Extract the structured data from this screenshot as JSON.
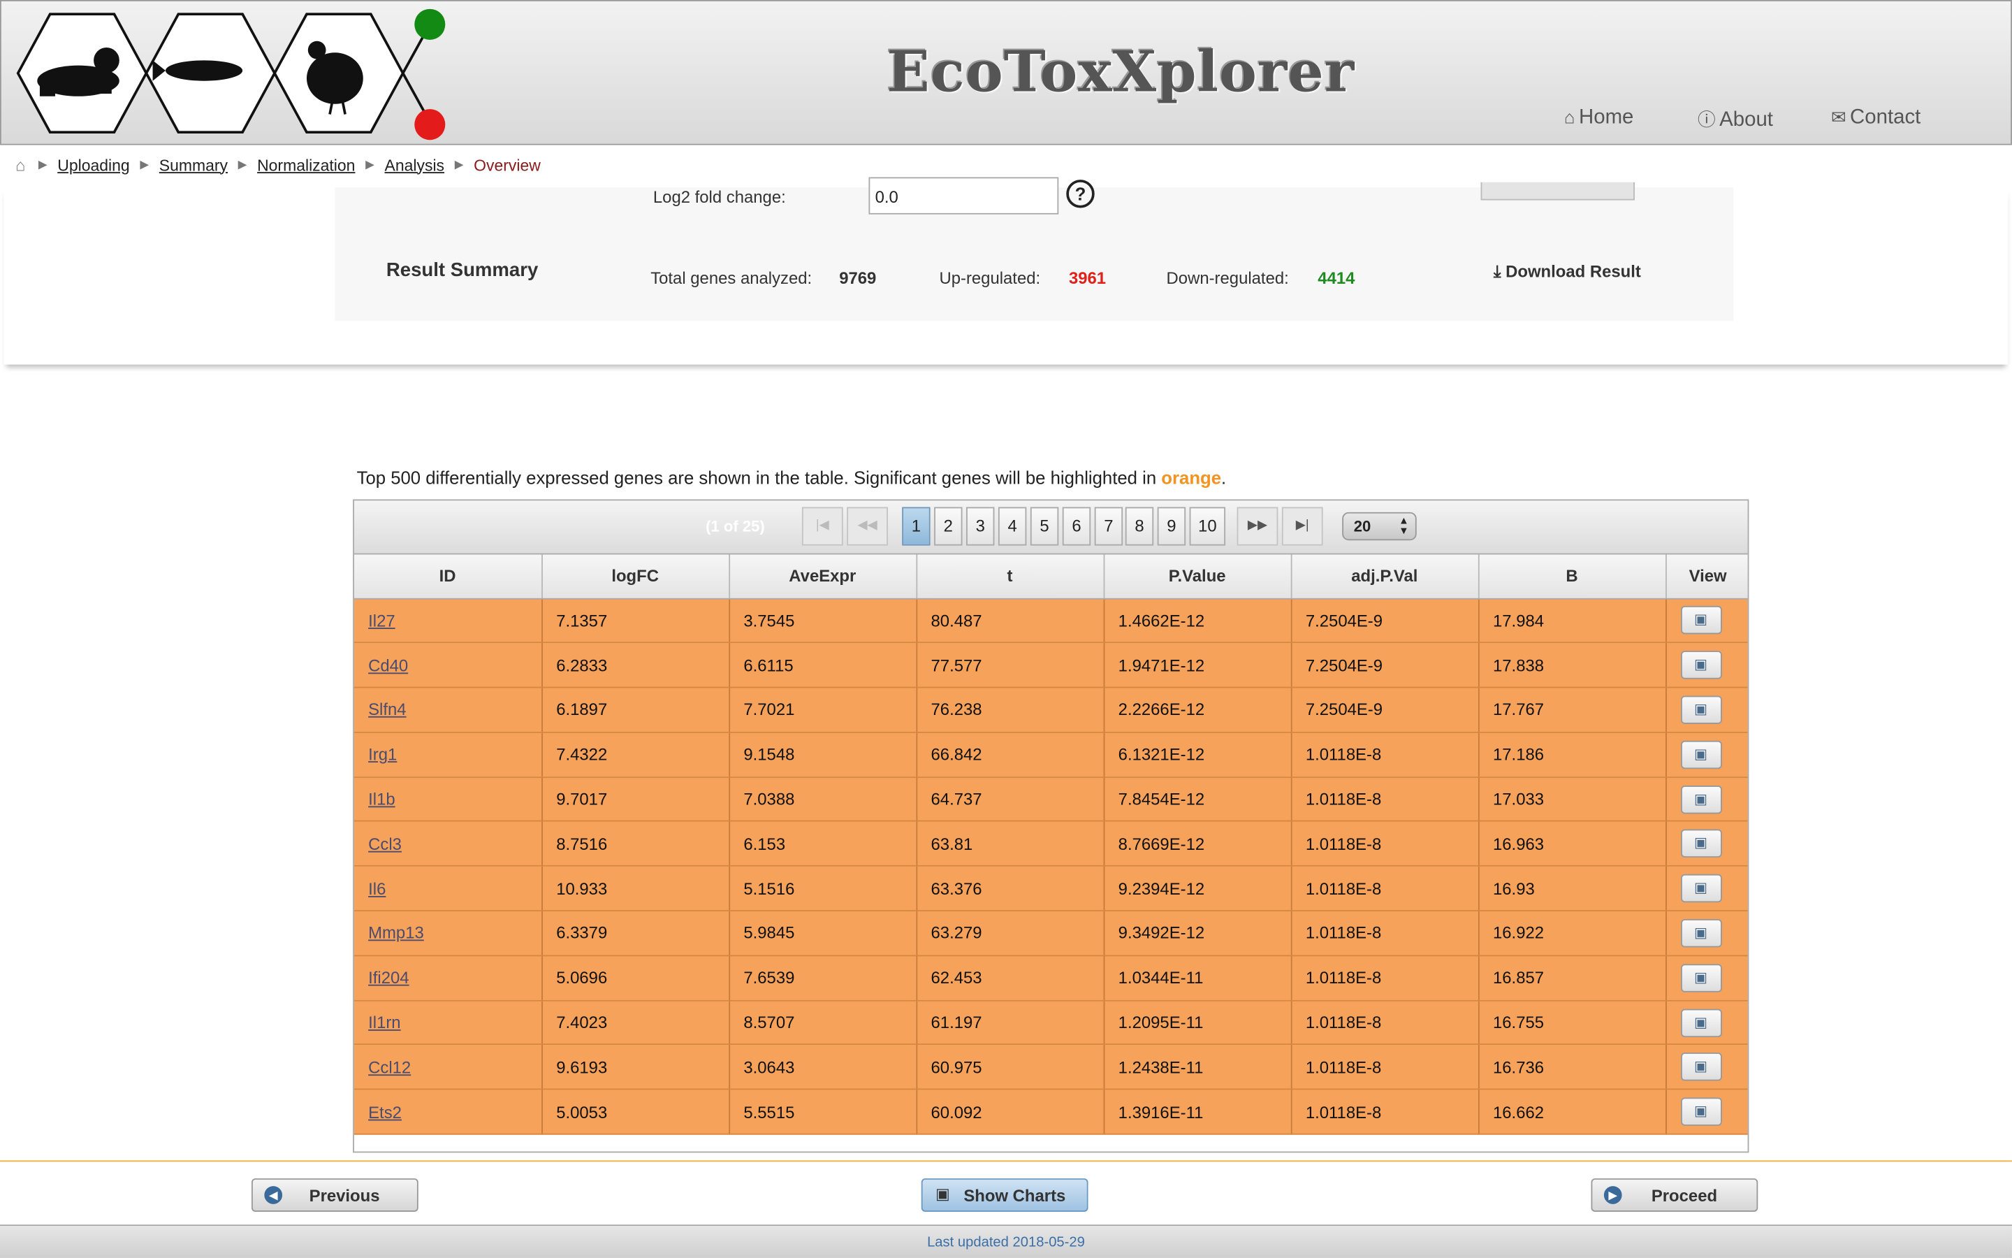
{
  "app": {
    "title": "EcoToxXplorer",
    "nav": {
      "home": "Home",
      "about": "About",
      "contact": "Contact"
    },
    "icons": {
      "home": "home-icon",
      "about": "info-icon",
      "contact": "envelope-icon"
    }
  },
  "breadcrumb": {
    "items": [
      "Uploading",
      "Summary",
      "Normalization",
      "Analysis"
    ],
    "current": "Overview"
  },
  "filter": {
    "fold_change_label": "Log2 fold change:",
    "fold_change_value": "0.0"
  },
  "summary": {
    "title": "Result Summary",
    "total_label": "Total genes analyzed:",
    "total_value": "9769",
    "up_label": "Up-regulated:",
    "up_value": "3961",
    "down_label": "Down-regulated:",
    "down_value": "4414",
    "download_label": "Download Result",
    "colors": {
      "up": "#e0201a",
      "down": "#1f8a1f"
    }
  },
  "intro": {
    "text": "Top 500 differentially expressed genes are shown in the table. Significant genes will be highlighted in ",
    "highlight": "orange",
    "end": "."
  },
  "paginator": {
    "info": "(1 of 25)",
    "pages": [
      "1",
      "2",
      "3",
      "4",
      "5",
      "6",
      "7",
      "8",
      "9",
      "10"
    ],
    "active_page": "1",
    "rows_per_page": "20"
  },
  "table": {
    "columns": [
      "ID",
      "logFC",
      "AveExpr",
      "t",
      "P.Value",
      "adj.P.Val",
      "B",
      "View"
    ],
    "rows": [
      [
        "Il27",
        "7.1357",
        "3.7545",
        "80.487",
        "1.4662E-12",
        "7.2504E-9",
        "17.984"
      ],
      [
        "Cd40",
        "6.2833",
        "6.6115",
        "77.577",
        "1.9471E-12",
        "7.2504E-9",
        "17.838"
      ],
      [
        "Slfn4",
        "6.1897",
        "7.7021",
        "76.238",
        "2.2266E-12",
        "7.2504E-9",
        "17.767"
      ],
      [
        "Irg1",
        "7.4322",
        "9.1548",
        "66.842",
        "6.1321E-12",
        "1.0118E-8",
        "17.186"
      ],
      [
        "Il1b",
        "9.7017",
        "7.0388",
        "64.737",
        "7.8454E-12",
        "1.0118E-8",
        "17.033"
      ],
      [
        "Ccl3",
        "8.7516",
        "6.153",
        "63.81",
        "8.7669E-12",
        "1.0118E-8",
        "16.963"
      ],
      [
        "Il6",
        "10.933",
        "5.1516",
        "63.376",
        "9.2394E-12",
        "1.0118E-8",
        "16.93"
      ],
      [
        "Mmp13",
        "6.3379",
        "5.9845",
        "63.279",
        "9.3492E-12",
        "1.0118E-8",
        "16.922"
      ],
      [
        "Ifi204",
        "5.0696",
        "7.6539",
        "62.453",
        "1.0344E-11",
        "1.0118E-8",
        "16.857"
      ],
      [
        "Il1rn",
        "7.4023",
        "8.5707",
        "61.197",
        "1.2095E-11",
        "1.0118E-8",
        "16.755"
      ],
      [
        "Ccl12",
        "9.6193",
        "3.0643",
        "60.975",
        "1.2438E-11",
        "1.0118E-8",
        "16.736"
      ],
      [
        "Ets2",
        "5.0053",
        "5.5515",
        "60.092",
        "1.3916E-11",
        "1.0118E-8",
        "16.662"
      ]
    ],
    "highlight_color": "#f6a25a"
  },
  "footer": {
    "previous": "Previous",
    "show_charts": "Show Charts",
    "proceed": "Proceed",
    "updated": "Last updated 2018-05-29"
  }
}
